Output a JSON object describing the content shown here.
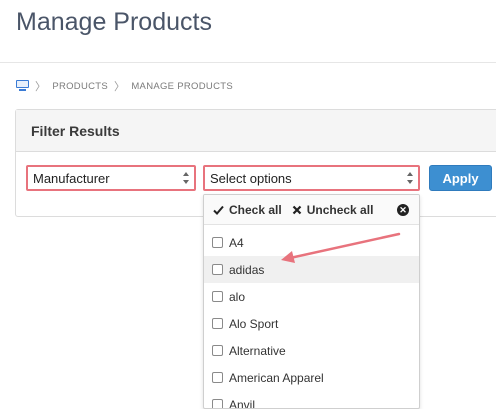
{
  "page": {
    "title": "Manage Products"
  },
  "breadcrumb": {
    "home_icon": "computer-icon",
    "items": [
      "PRODUCTS",
      "MANAGE PRODUCTS"
    ],
    "separator": "〉"
  },
  "filter": {
    "title": "Filter Results",
    "field_select": {
      "value": "Manufacturer"
    },
    "options_select": {
      "value": "Select options"
    },
    "apply_label": "Apply"
  },
  "dropdown": {
    "check_all_label": "Check all",
    "uncheck_all_label": "Uncheck all",
    "options": [
      {
        "label": "A4",
        "checked": false
      },
      {
        "label": "adidas",
        "checked": false,
        "highlighted": true
      },
      {
        "label": "alo",
        "checked": false
      },
      {
        "label": "Alo Sport",
        "checked": false
      },
      {
        "label": "Alternative",
        "checked": false
      },
      {
        "label": "American Apparel",
        "checked": false
      },
      {
        "label": "Anvil",
        "checked": false
      }
    ]
  },
  "colors": {
    "highlight_border": "#e8737d",
    "apply_button": "#3d8fd1",
    "annotation_arrow": "#e8737d"
  }
}
